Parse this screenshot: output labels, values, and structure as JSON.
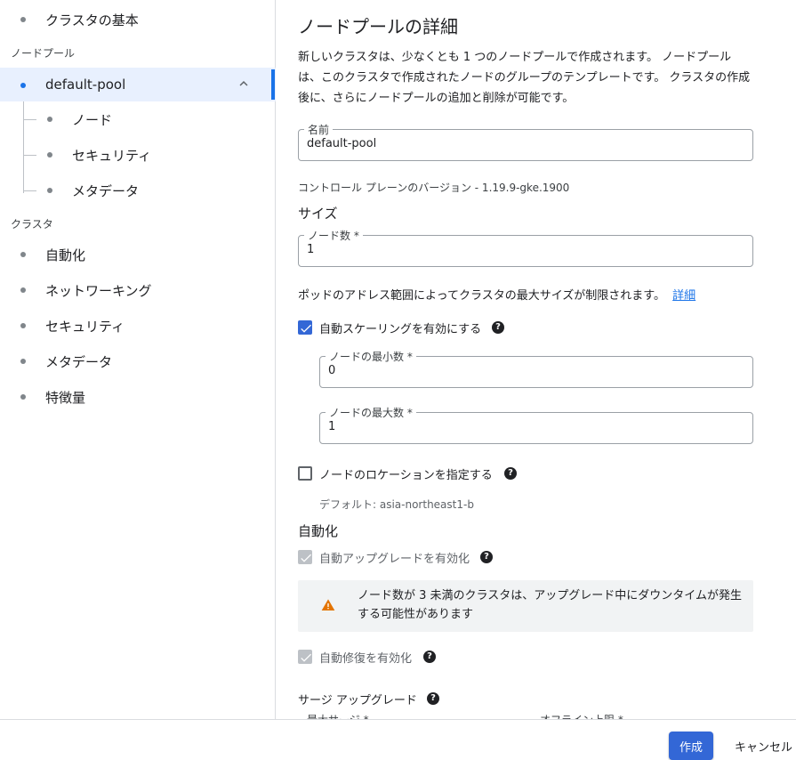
{
  "sidebar": {
    "items_top": [
      {
        "label": "クラスタの基本",
        "icon": "bullet-icon"
      }
    ],
    "section_node_pool": "ノードプール",
    "pool": {
      "label": "default-pool",
      "expand_icon": "chevron-up-icon"
    },
    "pool_children": [
      {
        "label": "ノード"
      },
      {
        "label": "セキュリティ"
      },
      {
        "label": "メタデータ"
      }
    ],
    "section_cluster": "クラスタ",
    "cluster_items": [
      {
        "label": "自動化"
      },
      {
        "label": "ネットワーキング"
      },
      {
        "label": "セキュリティ"
      },
      {
        "label": "メタデータ"
      },
      {
        "label": "特徴量"
      }
    ]
  },
  "main": {
    "title": "ノードプールの詳細",
    "description": "新しいクラスタは、少なくとも 1 つのノードプールで作成されます。 ノードプールは、このクラスタで作成されたノードのグループのテンプレートです。 クラスタの作成後に、さらにノードプールの追加と削除が可能です。",
    "name_field": {
      "label": "名前",
      "value": "default-pool"
    },
    "control_plane_version": "コントロール プレーンのバージョン - 1.19.9-gke.1900",
    "size_heading": "サイズ",
    "node_count_field": {
      "label": "ノード数 *",
      "value": "1"
    },
    "pod_range_text": "ポッドのアドレス範囲によってクラスタの最大サイズが制限されます。",
    "pod_range_link": "詳細",
    "autoscale": {
      "label": "自動スケーリングを有効にする",
      "checked": true
    },
    "min_nodes_field": {
      "label": "ノードの最小数 *",
      "value": "0"
    },
    "max_nodes_field": {
      "label": "ノードの最大数 *",
      "value": "1"
    },
    "locations": {
      "label": "ノードのロケーションを指定する",
      "checked": false
    },
    "default_location": "デフォルト: asia-northeast1-b",
    "automation_heading": "自動化",
    "auto_upgrade": {
      "label": "自動アップグレードを有効化",
      "checked": true,
      "disabled": true
    },
    "warning_text": "ノード数が 3 未満のクラスタは、アップグレード中にダウンタイムが発生する可能性があります",
    "auto_repair": {
      "label": "自動修復を有効化",
      "checked": true,
      "disabled": true
    },
    "surge_heading": "サージ アップグレード",
    "surge_max_label": "最大サージ *",
    "surge_unavailable_label": "オフライン上限 *",
    "help_glyph": "?"
  },
  "footer": {
    "create_label": "作成",
    "cancel_label": "キャンセル"
  },
  "colors": {
    "accent": "#1a73e8",
    "button": "#3367d6",
    "active_nav_bg": "#e8f0fe",
    "warning": "#e37400"
  }
}
